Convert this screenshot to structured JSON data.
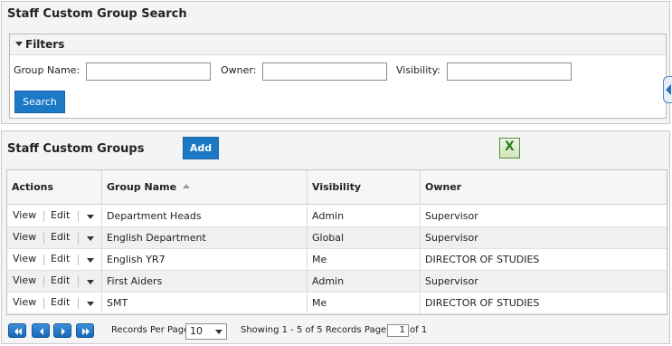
{
  "search_panel": {
    "title": "Staff Custom Group Search",
    "filters_label": "Filters",
    "fields": [
      {
        "label": "Group Name:",
        "value": "",
        "placeholder": ""
      },
      {
        "label": "Owner:",
        "value": "",
        "placeholder": ""
      },
      {
        "label": "Visibility:",
        "value": "",
        "placeholder": ""
      }
    ],
    "search_button": "Search"
  },
  "groups_panel": {
    "title": "Staff Custom Groups",
    "add_button": "Add",
    "excel_icon": "excel-export-icon",
    "columns": [
      "Actions",
      "Group Name",
      "Visibility",
      "Owner"
    ],
    "row_actions": {
      "view": "View",
      "edit": "Edit"
    },
    "rows": [
      {
        "group_name": "Department Heads",
        "visibility": "Admin",
        "owner": "Supervisor"
      },
      {
        "group_name": "English Department",
        "visibility": "Global",
        "owner": "Supervisor"
      },
      {
        "group_name": "English YR7",
        "visibility": "Me",
        "owner": "DIRECTOR OF STUDIES"
      },
      {
        "group_name": "First Aiders",
        "visibility": "Admin",
        "owner": "Supervisor"
      },
      {
        "group_name": "SMT",
        "visibility": "Me",
        "owner": "DIRECTOR OF STUDIES"
      }
    ]
  },
  "pager": {
    "records_per_page_label": "Records Per Page",
    "records_per_page": "10",
    "showing": "Showing 1 - 5 of 5 Records",
    "page_label": "Page",
    "page_value": "1",
    "of_label": "of 1"
  },
  "colors": {
    "accent_blue": "#1b79c6",
    "panel_bg": "#f4f4f4",
    "alt_row": "#f0f0f0"
  }
}
